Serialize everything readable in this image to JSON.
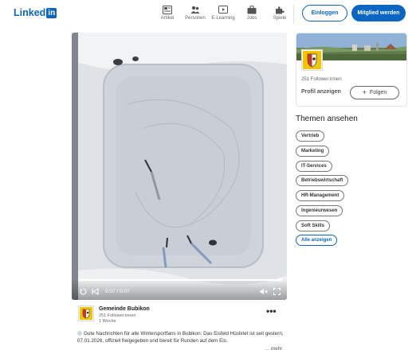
{
  "header": {
    "logo_text": "Linked",
    "logo_badge": "in",
    "nav": [
      {
        "label": "Artikel",
        "icon": "article-icon"
      },
      {
        "label": "Personen",
        "icon": "people-icon"
      },
      {
        "label": "E-Learning",
        "icon": "learning-icon"
      },
      {
        "label": "Jobs",
        "icon": "briefcase-icon"
      },
      {
        "label": "Spiele",
        "icon": "puzzle-icon"
      }
    ],
    "login_label": "Einloggen",
    "join_label": "Mitglied werden",
    "brand_color": "#0a66c2"
  },
  "video": {
    "timecode": "0:07 / 0:07",
    "progress": 1.0
  },
  "post": {
    "company": "Gemeinde Bubikon",
    "followers": "251 Follower:innen",
    "time": "1 Woche",
    "text": "Gute Nachrichten für alle Wintersportfans in Bubikon: Das Eisfeld Hüsliriet ist seit gestern, 07.01.2026, offiziell freigegeben und bereit für Runden auf dem Eis.",
    "more": "… mehr",
    "menu": "•••"
  },
  "card": {
    "followers": "251 Follower:innen",
    "profile_link": "Profil anzeigen",
    "follow_label": "Folgen"
  },
  "topics": {
    "title": "Themen ansehen",
    "items": [
      "Vertrieb",
      "Marketing",
      "IT-Services",
      "Betriebswirtschaft",
      "HR-Management",
      "Ingenieurwesen",
      "Soft Skills"
    ],
    "all_label": "Alle anzeigen"
  }
}
